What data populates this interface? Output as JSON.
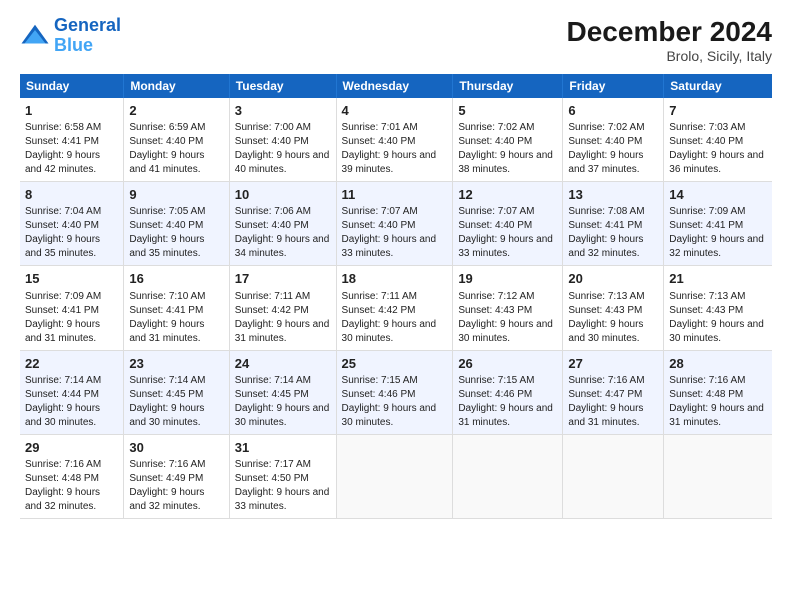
{
  "logo": {
    "line1": "General",
    "line2": "Blue"
  },
  "title": "December 2024",
  "subtitle": "Brolo, Sicily, Italy",
  "days_header": [
    "Sunday",
    "Monday",
    "Tuesday",
    "Wednesday",
    "Thursday",
    "Friday",
    "Saturday"
  ],
  "weeks": [
    [
      {
        "day": "1",
        "sunrise": "Sunrise: 6:58 AM",
        "sunset": "Sunset: 4:41 PM",
        "daylight": "Daylight: 9 hours and 42 minutes."
      },
      {
        "day": "2",
        "sunrise": "Sunrise: 6:59 AM",
        "sunset": "Sunset: 4:40 PM",
        "daylight": "Daylight: 9 hours and 41 minutes."
      },
      {
        "day": "3",
        "sunrise": "Sunrise: 7:00 AM",
        "sunset": "Sunset: 4:40 PM",
        "daylight": "Daylight: 9 hours and 40 minutes."
      },
      {
        "day": "4",
        "sunrise": "Sunrise: 7:01 AM",
        "sunset": "Sunset: 4:40 PM",
        "daylight": "Daylight: 9 hours and 39 minutes."
      },
      {
        "day": "5",
        "sunrise": "Sunrise: 7:02 AM",
        "sunset": "Sunset: 4:40 PM",
        "daylight": "Daylight: 9 hours and 38 minutes."
      },
      {
        "day": "6",
        "sunrise": "Sunrise: 7:02 AM",
        "sunset": "Sunset: 4:40 PM",
        "daylight": "Daylight: 9 hours and 37 minutes."
      },
      {
        "day": "7",
        "sunrise": "Sunrise: 7:03 AM",
        "sunset": "Sunset: 4:40 PM",
        "daylight": "Daylight: 9 hours and 36 minutes."
      }
    ],
    [
      {
        "day": "8",
        "sunrise": "Sunrise: 7:04 AM",
        "sunset": "Sunset: 4:40 PM",
        "daylight": "Daylight: 9 hours and 35 minutes."
      },
      {
        "day": "9",
        "sunrise": "Sunrise: 7:05 AM",
        "sunset": "Sunset: 4:40 PM",
        "daylight": "Daylight: 9 hours and 35 minutes."
      },
      {
        "day": "10",
        "sunrise": "Sunrise: 7:06 AM",
        "sunset": "Sunset: 4:40 PM",
        "daylight": "Daylight: 9 hours and 34 minutes."
      },
      {
        "day": "11",
        "sunrise": "Sunrise: 7:07 AM",
        "sunset": "Sunset: 4:40 PM",
        "daylight": "Daylight: 9 hours and 33 minutes."
      },
      {
        "day": "12",
        "sunrise": "Sunrise: 7:07 AM",
        "sunset": "Sunset: 4:40 PM",
        "daylight": "Daylight: 9 hours and 33 minutes."
      },
      {
        "day": "13",
        "sunrise": "Sunrise: 7:08 AM",
        "sunset": "Sunset: 4:41 PM",
        "daylight": "Daylight: 9 hours and 32 minutes."
      },
      {
        "day": "14",
        "sunrise": "Sunrise: 7:09 AM",
        "sunset": "Sunset: 4:41 PM",
        "daylight": "Daylight: 9 hours and 32 minutes."
      }
    ],
    [
      {
        "day": "15",
        "sunrise": "Sunrise: 7:09 AM",
        "sunset": "Sunset: 4:41 PM",
        "daylight": "Daylight: 9 hours and 31 minutes."
      },
      {
        "day": "16",
        "sunrise": "Sunrise: 7:10 AM",
        "sunset": "Sunset: 4:41 PM",
        "daylight": "Daylight: 9 hours and 31 minutes."
      },
      {
        "day": "17",
        "sunrise": "Sunrise: 7:11 AM",
        "sunset": "Sunset: 4:42 PM",
        "daylight": "Daylight: 9 hours and 31 minutes."
      },
      {
        "day": "18",
        "sunrise": "Sunrise: 7:11 AM",
        "sunset": "Sunset: 4:42 PM",
        "daylight": "Daylight: 9 hours and 30 minutes."
      },
      {
        "day": "19",
        "sunrise": "Sunrise: 7:12 AM",
        "sunset": "Sunset: 4:43 PM",
        "daylight": "Daylight: 9 hours and 30 minutes."
      },
      {
        "day": "20",
        "sunrise": "Sunrise: 7:13 AM",
        "sunset": "Sunset: 4:43 PM",
        "daylight": "Daylight: 9 hours and 30 minutes."
      },
      {
        "day": "21",
        "sunrise": "Sunrise: 7:13 AM",
        "sunset": "Sunset: 4:43 PM",
        "daylight": "Daylight: 9 hours and 30 minutes."
      }
    ],
    [
      {
        "day": "22",
        "sunrise": "Sunrise: 7:14 AM",
        "sunset": "Sunset: 4:44 PM",
        "daylight": "Daylight: 9 hours and 30 minutes."
      },
      {
        "day": "23",
        "sunrise": "Sunrise: 7:14 AM",
        "sunset": "Sunset: 4:45 PM",
        "daylight": "Daylight: 9 hours and 30 minutes."
      },
      {
        "day": "24",
        "sunrise": "Sunrise: 7:14 AM",
        "sunset": "Sunset: 4:45 PM",
        "daylight": "Daylight: 9 hours and 30 minutes."
      },
      {
        "day": "25",
        "sunrise": "Sunrise: 7:15 AM",
        "sunset": "Sunset: 4:46 PM",
        "daylight": "Daylight: 9 hours and 30 minutes."
      },
      {
        "day": "26",
        "sunrise": "Sunrise: 7:15 AM",
        "sunset": "Sunset: 4:46 PM",
        "daylight": "Daylight: 9 hours and 31 minutes."
      },
      {
        "day": "27",
        "sunrise": "Sunrise: 7:16 AM",
        "sunset": "Sunset: 4:47 PM",
        "daylight": "Daylight: 9 hours and 31 minutes."
      },
      {
        "day": "28",
        "sunrise": "Sunrise: 7:16 AM",
        "sunset": "Sunset: 4:48 PM",
        "daylight": "Daylight: 9 hours and 31 minutes."
      }
    ],
    [
      {
        "day": "29",
        "sunrise": "Sunrise: 7:16 AM",
        "sunset": "Sunset: 4:48 PM",
        "daylight": "Daylight: 9 hours and 32 minutes."
      },
      {
        "day": "30",
        "sunrise": "Sunrise: 7:16 AM",
        "sunset": "Sunset: 4:49 PM",
        "daylight": "Daylight: 9 hours and 32 minutes."
      },
      {
        "day": "31",
        "sunrise": "Sunrise: 7:17 AM",
        "sunset": "Sunset: 4:50 PM",
        "daylight": "Daylight: 9 hours and 33 minutes."
      },
      null,
      null,
      null,
      null
    ]
  ]
}
